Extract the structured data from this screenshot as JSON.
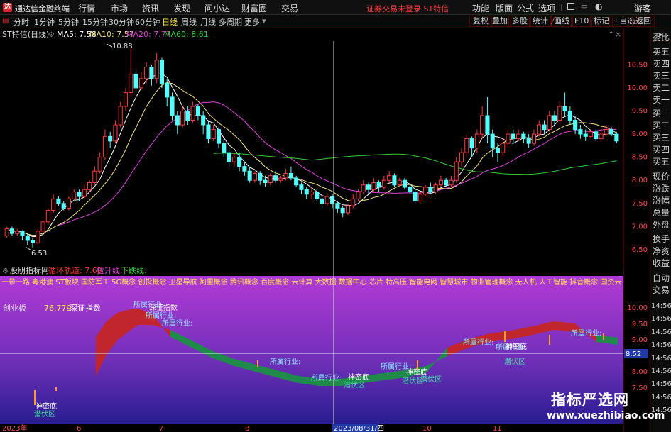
{
  "titlebar": {
    "logo_text": "达",
    "app_title": "通达信金融终端",
    "menu": [
      "行情",
      "市场",
      "资讯",
      "发现",
      "问小达",
      "财富圈",
      "交易"
    ],
    "notice": "证券交易未登录  ST特信",
    "right_menu": [
      "功能",
      "版面",
      "公式",
      "选项"
    ],
    "guest": "游客"
  },
  "periodbar": {
    "periods": [
      "分时",
      "1分钟",
      "5分钟",
      "15分钟",
      "30分钟",
      "60分钟",
      "日线",
      "周线",
      "月线",
      "多周期",
      "更多"
    ],
    "active": "日线",
    "tools": [
      "复权",
      "叠加",
      "多股",
      "统计",
      "画线",
      "F10",
      "标记",
      "+自选",
      "返回"
    ]
  },
  "main_chart": {
    "stock_title": "ST特信(日线)",
    "ma": [
      {
        "label": "MA5: 7.58",
        "color": "#ffffff"
      },
      {
        "label": "MA10: 7.57",
        "color": "#f5e27a"
      },
      {
        "label": "MA20: 7.77",
        "color": "#e040e0"
      },
      {
        "label": "MA60: 8.61",
        "color": "#33cc33"
      }
    ],
    "high_label": "10.88",
    "low_label": "6.53",
    "yticks": [
      "10.50",
      "10.00",
      "9.50",
      "9.00",
      "8.50",
      "8.00",
      "7.50",
      "7.00",
      "6.50"
    ]
  },
  "indicator": {
    "title": "股朋指标网",
    "legend": [
      {
        "label": "循环轨道: 7.69",
        "color": "#ff3030"
      },
      {
        "label": "拉升线:",
        "color": "#e040e0"
      },
      {
        "label": "下跌线:",
        "color": "#33cc33"
      }
    ],
    "concepts": "一带一路 粤港澳 ST板块 国防军工 5G概念 创投概念 卫星导航 阿里概念 腾讯概念 百度概念 云计算 大数据 数据中心 芯片 特高压 智能电网 智慧城市 物业管理概念 无人机 人工智能 抖音概念 国资云 信创 东",
    "left_board": "创业板",
    "left_value": "76.779",
    "left_text": "深证指数",
    "overlay_labels": {
      "industry": "所属行业:",
      "bottom": "神密底",
      "latent": "潜伏区",
      "index_text": "深证指数"
    },
    "yticks": [
      "10.00",
      "9.50",
      "9.00",
      "8.50",
      "8.00",
      "7.50"
    ],
    "current_value": "8.52",
    "time_ticks": [
      "14:56",
      "14:56",
      "14:56",
      "14:56",
      "14:56",
      "14:56",
      "14:56",
      "14:56",
      "14:56"
    ],
    "right_labels": [
      "自动",
      "交易"
    ]
  },
  "x_axis": {
    "labels": [
      "2023年",
      "6",
      "7",
      "8",
      "2023/08/31/四",
      "10",
      "11"
    ]
  },
  "right_tabs": [
    "委比",
    "卖五",
    "卖四",
    "卖三",
    "卖二",
    "卖一",
    "买一",
    "买二",
    "买三",
    "买四",
    "买五",
    "现价",
    "涨跌",
    "涨幅",
    "总量",
    "外盘",
    "换手",
    "净资",
    "收益"
  ],
  "watermark": {
    "line1": "指标严选网",
    "line2": "www.xuezhibiao.com"
  },
  "colors": {
    "up": "#ff3b3b",
    "down": "#54ffff",
    "ma5": "#ffffff",
    "ma10": "#f5e27a",
    "ma20": "#e040e0",
    "ma60": "#33cc33",
    "accent_red": "#d9262c"
  },
  "chart_data": {
    "type": "candlestick",
    "ylim": [
      6.3,
      10.95
    ],
    "candles": [
      [
        6.8,
        6.95,
        6.75,
        7.0
      ],
      [
        6.95,
        6.85,
        6.8,
        7.0
      ],
      [
        6.85,
        6.9,
        6.8,
        6.95
      ],
      [
        6.9,
        6.8,
        6.7,
        6.92
      ],
      [
        6.8,
        6.7,
        6.6,
        6.85
      ],
      [
        6.7,
        6.65,
        6.53,
        6.75
      ],
      [
        6.65,
        6.9,
        6.6,
        6.95
      ],
      [
        6.9,
        7.1,
        6.85,
        7.15
      ],
      [
        7.1,
        7.35,
        7.05,
        7.4
      ],
      [
        7.35,
        7.6,
        7.3,
        7.7
      ],
      [
        7.6,
        7.5,
        7.45,
        7.65
      ],
      [
        7.5,
        7.4,
        7.35,
        7.55
      ],
      [
        7.4,
        7.6,
        7.35,
        7.65
      ],
      [
        7.6,
        7.75,
        7.55,
        7.8
      ],
      [
        7.75,
        7.65,
        7.55,
        7.8
      ],
      [
        7.65,
        7.8,
        7.6,
        7.9
      ],
      [
        7.8,
        7.95,
        7.75,
        8.0
      ],
      [
        7.95,
        8.2,
        7.9,
        8.3
      ],
      [
        8.2,
        8.5,
        8.15,
        8.6
      ],
      [
        8.5,
        8.95,
        8.45,
        9.1
      ],
      [
        8.95,
        8.85,
        8.7,
        9.05
      ],
      [
        8.85,
        9.2,
        8.8,
        9.3
      ],
      [
        9.2,
        9.6,
        9.15,
        9.7
      ],
      [
        9.6,
        9.9,
        9.5,
        10.0
      ],
      [
        9.9,
        10.3,
        9.8,
        10.88
      ],
      [
        10.3,
        10.0,
        9.9,
        10.4
      ],
      [
        10.0,
        10.2,
        9.95,
        10.35
      ],
      [
        10.2,
        10.45,
        10.1,
        10.55
      ],
      [
        10.45,
        10.2,
        10.05,
        10.5
      ],
      [
        10.2,
        10.6,
        10.1,
        10.75
      ],
      [
        10.6,
        10.1,
        10.0,
        10.65
      ],
      [
        10.1,
        9.8,
        9.6,
        10.2
      ],
      [
        9.8,
        9.4,
        9.3,
        9.9
      ],
      [
        9.4,
        9.2,
        9.0,
        9.5
      ],
      [
        9.2,
        9.5,
        9.15,
        9.6
      ],
      [
        9.5,
        9.3,
        9.2,
        9.6
      ],
      [
        9.3,
        9.6,
        9.25,
        9.7
      ],
      [
        9.6,
        9.4,
        9.3,
        9.65
      ],
      [
        9.4,
        9.2,
        9.0,
        9.5
      ],
      [
        9.2,
        8.9,
        8.8,
        9.3
      ],
      [
        8.9,
        9.1,
        8.85,
        9.2
      ],
      [
        9.1,
        8.8,
        8.7,
        9.15
      ],
      [
        8.8,
        8.6,
        8.5,
        8.9
      ],
      [
        8.6,
        8.4,
        8.3,
        8.7
      ],
      [
        8.4,
        8.5,
        8.3,
        8.6
      ],
      [
        8.5,
        8.3,
        8.2,
        8.6
      ],
      [
        8.3,
        8.2,
        8.1,
        8.4
      ],
      [
        8.2,
        8.0,
        7.95,
        8.3
      ],
      [
        8.0,
        8.15,
        7.95,
        8.2
      ],
      [
        8.15,
        8.0,
        7.9,
        8.2
      ],
      [
        8.0,
        7.95,
        7.85,
        8.1
      ],
      [
        7.95,
        8.1,
        7.9,
        8.15
      ],
      [
        8.1,
        8.0,
        7.95,
        8.2
      ],
      [
        8.0,
        8.05,
        7.95,
        8.1
      ],
      [
        8.05,
        8.15,
        8.0,
        8.25
      ],
      [
        8.15,
        8.05,
        8.0,
        8.3
      ],
      [
        8.05,
        7.9,
        7.85,
        8.1
      ],
      [
        7.9,
        7.8,
        7.7,
        7.95
      ],
      [
        7.8,
        7.7,
        7.6,
        7.85
      ],
      [
        7.7,
        7.75,
        7.6,
        7.85
      ],
      [
        7.75,
        7.6,
        7.55,
        7.8
      ],
      [
        7.6,
        7.5,
        7.4,
        7.65
      ],
      [
        7.5,
        7.65,
        7.45,
        7.7
      ],
      [
        7.65,
        7.5,
        7.4,
        7.7
      ],
      [
        7.5,
        7.4,
        7.3,
        7.55
      ],
      [
        7.4,
        7.3,
        7.2,
        7.45
      ],
      [
        7.3,
        7.45,
        7.25,
        7.5
      ],
      [
        7.45,
        7.6,
        7.4,
        7.7
      ],
      [
        7.6,
        7.75,
        7.55,
        7.8
      ],
      [
        7.75,
        7.9,
        7.7,
        8.0
      ],
      [
        7.9,
        7.8,
        7.7,
        7.95
      ],
      [
        7.8,
        7.95,
        7.75,
        8.05
      ],
      [
        7.95,
        7.85,
        7.75,
        8.0
      ],
      [
        7.85,
        8.0,
        7.8,
        8.1
      ],
      [
        8.0,
        8.1,
        7.95,
        8.2
      ],
      [
        8.1,
        7.9,
        7.85,
        8.15
      ],
      [
        7.9,
        8.0,
        7.85,
        8.05
      ],
      [
        8.0,
        7.85,
        7.8,
        8.05
      ],
      [
        7.85,
        7.75,
        7.7,
        7.9
      ],
      [
        7.75,
        7.55,
        7.5,
        7.8
      ],
      [
        7.55,
        7.7,
        7.5,
        7.75
      ],
      [
        7.7,
        7.85,
        7.65,
        7.9
      ],
      [
        7.85,
        7.75,
        7.7,
        7.95
      ],
      [
        7.75,
        7.9,
        7.7,
        7.95
      ],
      [
        7.9,
        8.0,
        7.85,
        8.1
      ],
      [
        8.0,
        7.9,
        7.85,
        8.05
      ],
      [
        7.9,
        8.0,
        7.85,
        8.1
      ],
      [
        8.0,
        8.4,
        7.95,
        8.5
      ],
      [
        8.4,
        8.6,
        8.3,
        8.7
      ],
      [
        8.6,
        8.9,
        8.5,
        9.0
      ],
      [
        8.9,
        8.7,
        8.5,
        8.95
      ],
      [
        8.7,
        9.0,
        8.6,
        9.1
      ],
      [
        9.0,
        9.4,
        8.9,
        9.6
      ],
      [
        9.4,
        9.0,
        8.8,
        9.8
      ],
      [
        9.0,
        8.7,
        8.5,
        9.1
      ],
      [
        8.7,
        8.6,
        8.4,
        8.8
      ],
      [
        8.6,
        8.8,
        8.5,
        8.9
      ],
      [
        8.8,
        9.0,
        8.7,
        9.1
      ],
      [
        9.0,
        8.9,
        8.8,
        9.1
      ],
      [
        8.9,
        9.0,
        8.85,
        9.1
      ],
      [
        9.0,
        8.9,
        8.8,
        9.05
      ],
      [
        8.9,
        8.8,
        8.7,
        9.0
      ],
      [
        8.8,
        9.0,
        8.75,
        9.1
      ],
      [
        9.0,
        9.2,
        8.95,
        9.3
      ],
      [
        9.2,
        9.1,
        9.0,
        9.3
      ],
      [
        9.1,
        9.4,
        9.05,
        9.5
      ],
      [
        9.4,
        9.3,
        9.2,
        9.5
      ],
      [
        9.3,
        9.6,
        9.25,
        9.7
      ],
      [
        9.6,
        9.5,
        9.4,
        9.9
      ],
      [
        9.5,
        9.3,
        9.2,
        9.6
      ],
      [
        9.3,
        9.1,
        9.0,
        9.4
      ],
      [
        9.1,
        9.0,
        8.9,
        9.2
      ],
      [
        9.0,
        8.95,
        8.85,
        9.1
      ],
      [
        8.95,
        9.05,
        8.9,
        9.1
      ],
      [
        9.05,
        8.9,
        8.85,
        9.1
      ],
      [
        8.9,
        9.0,
        8.85,
        9.1
      ],
      [
        9.0,
        9.1,
        8.95,
        9.2
      ],
      [
        9.1,
        9.0,
        8.95,
        9.15
      ],
      [
        9.0,
        8.85,
        8.8,
        9.05
      ]
    ]
  }
}
